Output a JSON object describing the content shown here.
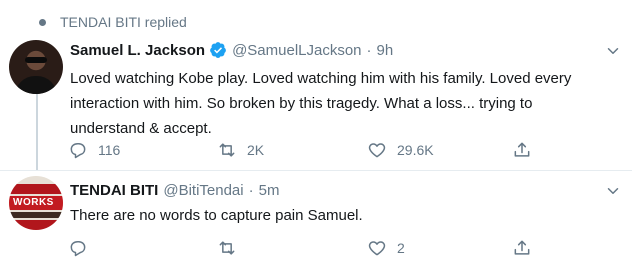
{
  "context": {
    "replied_label": "TENDAI BITI replied"
  },
  "tweets": [
    {
      "name": "Samuel L. Jackson",
      "handle": "@SamuelLJackson",
      "sep": "·",
      "time": "9h",
      "lines": [
        "Loved watching Kobe play. Loved watching him with his family. Loved every",
        "interaction with him. So broken by this tragedy. What a loss... trying to",
        "understand & accept."
      ],
      "replies": "116",
      "retweets": "2K",
      "likes": "29.6K",
      "verified": true
    },
    {
      "name": "TENDAI BITI",
      "handle": "@BitiTendai",
      "sep": "·",
      "time": "5m",
      "lines": [
        "There are no words to capture pain Samuel."
      ],
      "replies": "",
      "retweets": "",
      "likes": "2",
      "avatar_text": "WORKS"
    }
  ],
  "colors": {
    "muted": "#657786",
    "verified": "#1da1f2",
    "divider": "#e6ecf0"
  }
}
